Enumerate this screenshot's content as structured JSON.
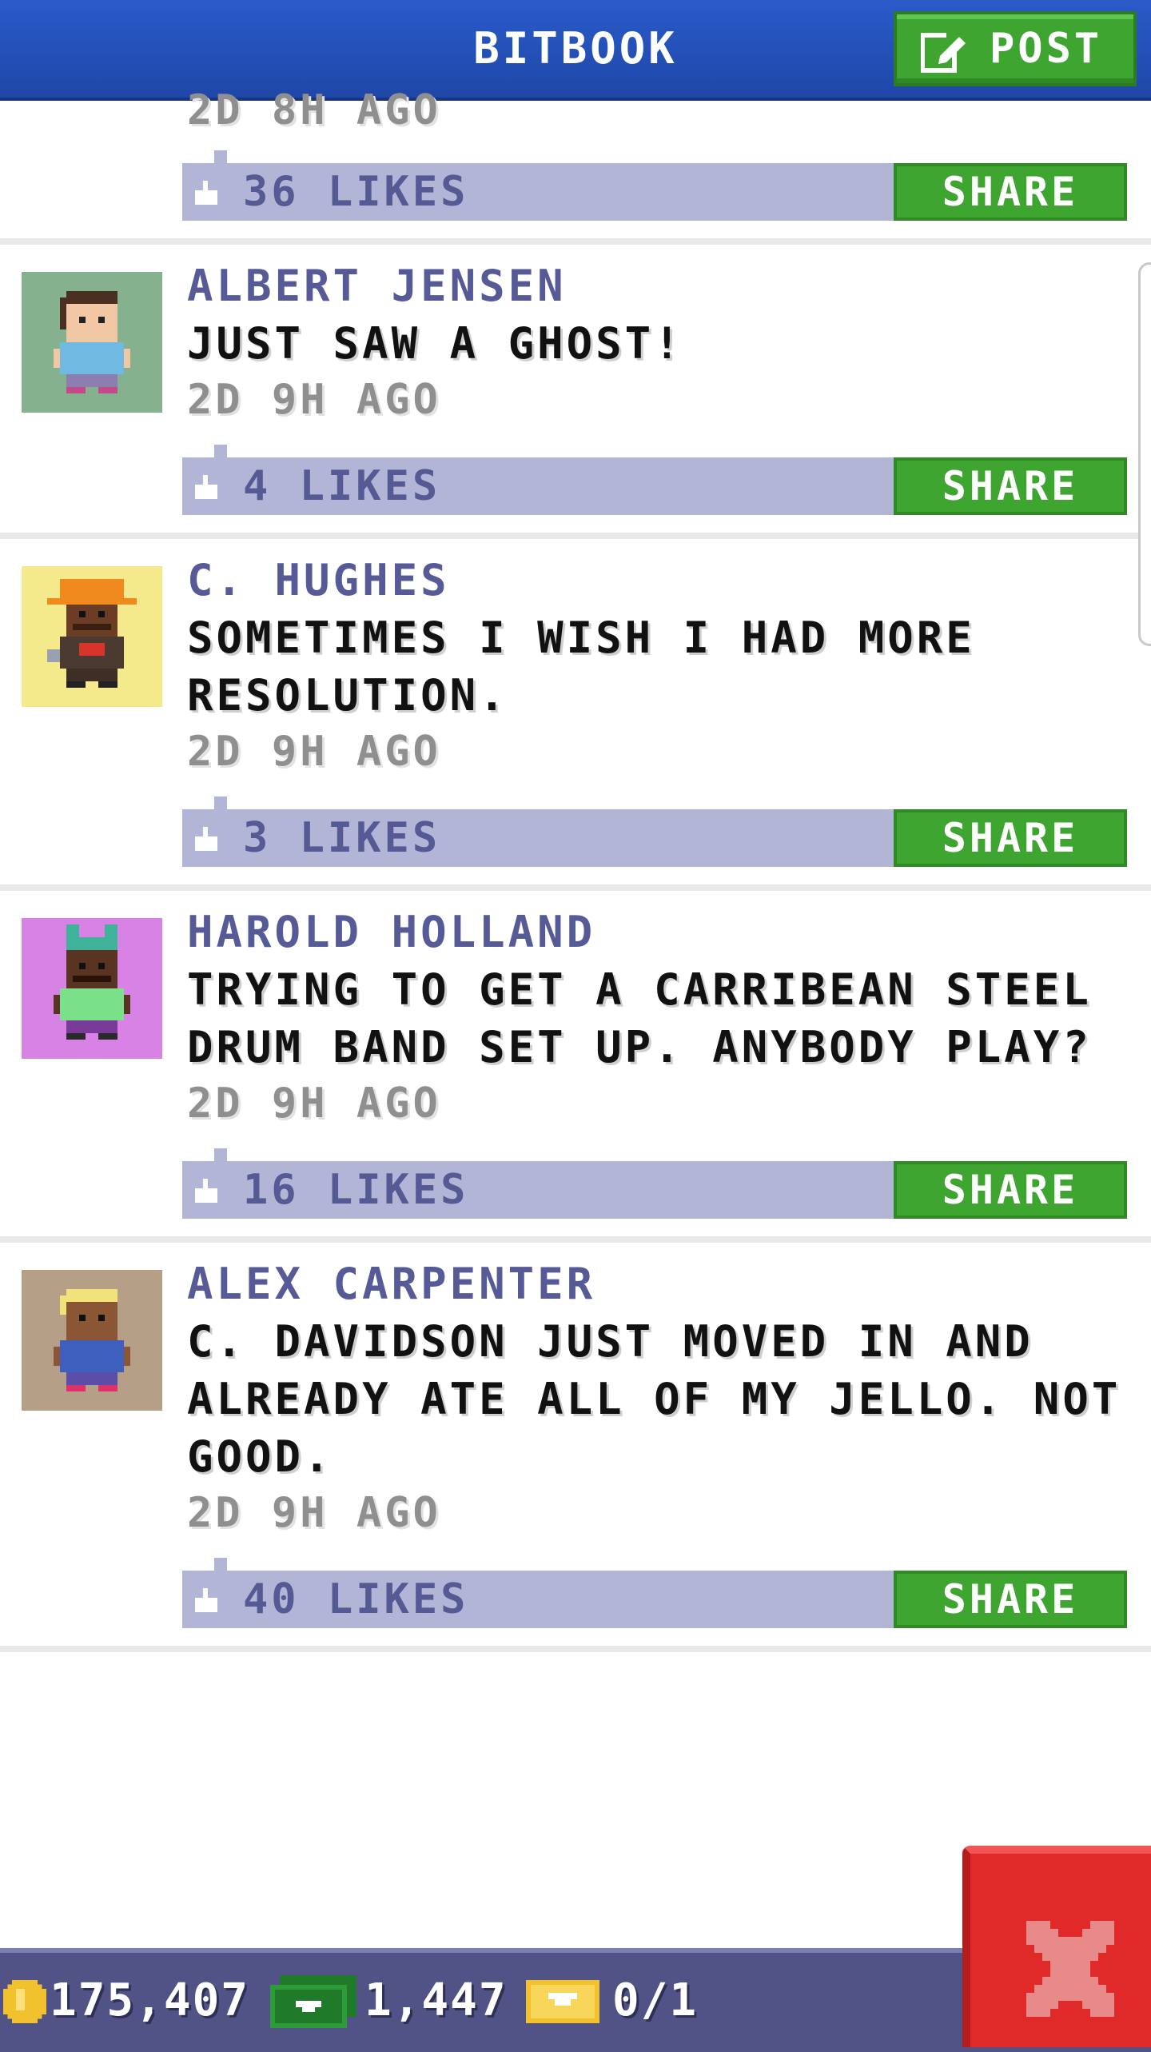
{
  "header": {
    "title": "BITBOOK",
    "post_label": "POST"
  },
  "feed": {
    "partial_post": {
      "time": "2D 8H AGO",
      "likes": "36 LIKES",
      "share": "SHARE"
    },
    "posts": [
      {
        "author": "ALBERT JENSEN",
        "text": "JUST SAW A GHOST!",
        "time": "2D 9H AGO",
        "likes": "4 LIKES",
        "share": "SHARE",
        "avatar_bg": "#86b18e"
      },
      {
        "author": "C. HUGHES",
        "text": "SOMETIMES I WISH I HAD MORE RESOLUTION.",
        "time": "2D 9H AGO",
        "likes": "3 LIKES",
        "share": "SHARE",
        "avatar_bg": "#f4ea8c"
      },
      {
        "author": "HAROLD HOLLAND",
        "text": "TRYING TO GET A CARRIBEAN STEEL DRUM BAND SET UP. ANYBODY PLAY?",
        "time": "2D 9H AGO",
        "likes": "16 LIKES",
        "share": "SHARE",
        "avatar_bg": "#d882e6"
      },
      {
        "author": "ALEX CARPENTER",
        "text": "C. DAVIDSON JUST MOVED IN AND ALREADY ATE ALL OF MY JELLO. NOT GOOD.",
        "time": "2D 9H AGO",
        "likes": "40 LIKES",
        "share": "SHARE",
        "avatar_bg": "#b59f86"
      }
    ]
  },
  "status_bar": {
    "coins": "175,407",
    "bux": "1,447",
    "tickets": "0/1"
  },
  "icons": {
    "post": "edit-icon",
    "like": "thumbs-up-icon",
    "coin": "coin-icon",
    "bux": "bux-icon",
    "ticket": "ticket-icon",
    "close": "close-icon"
  },
  "colors": {
    "header": "#2250b8",
    "share": "#3ea530",
    "like_bar": "#b3b5d7",
    "author": "#565a96",
    "bottom_bar": "#515387",
    "close": "#e02a2a"
  }
}
